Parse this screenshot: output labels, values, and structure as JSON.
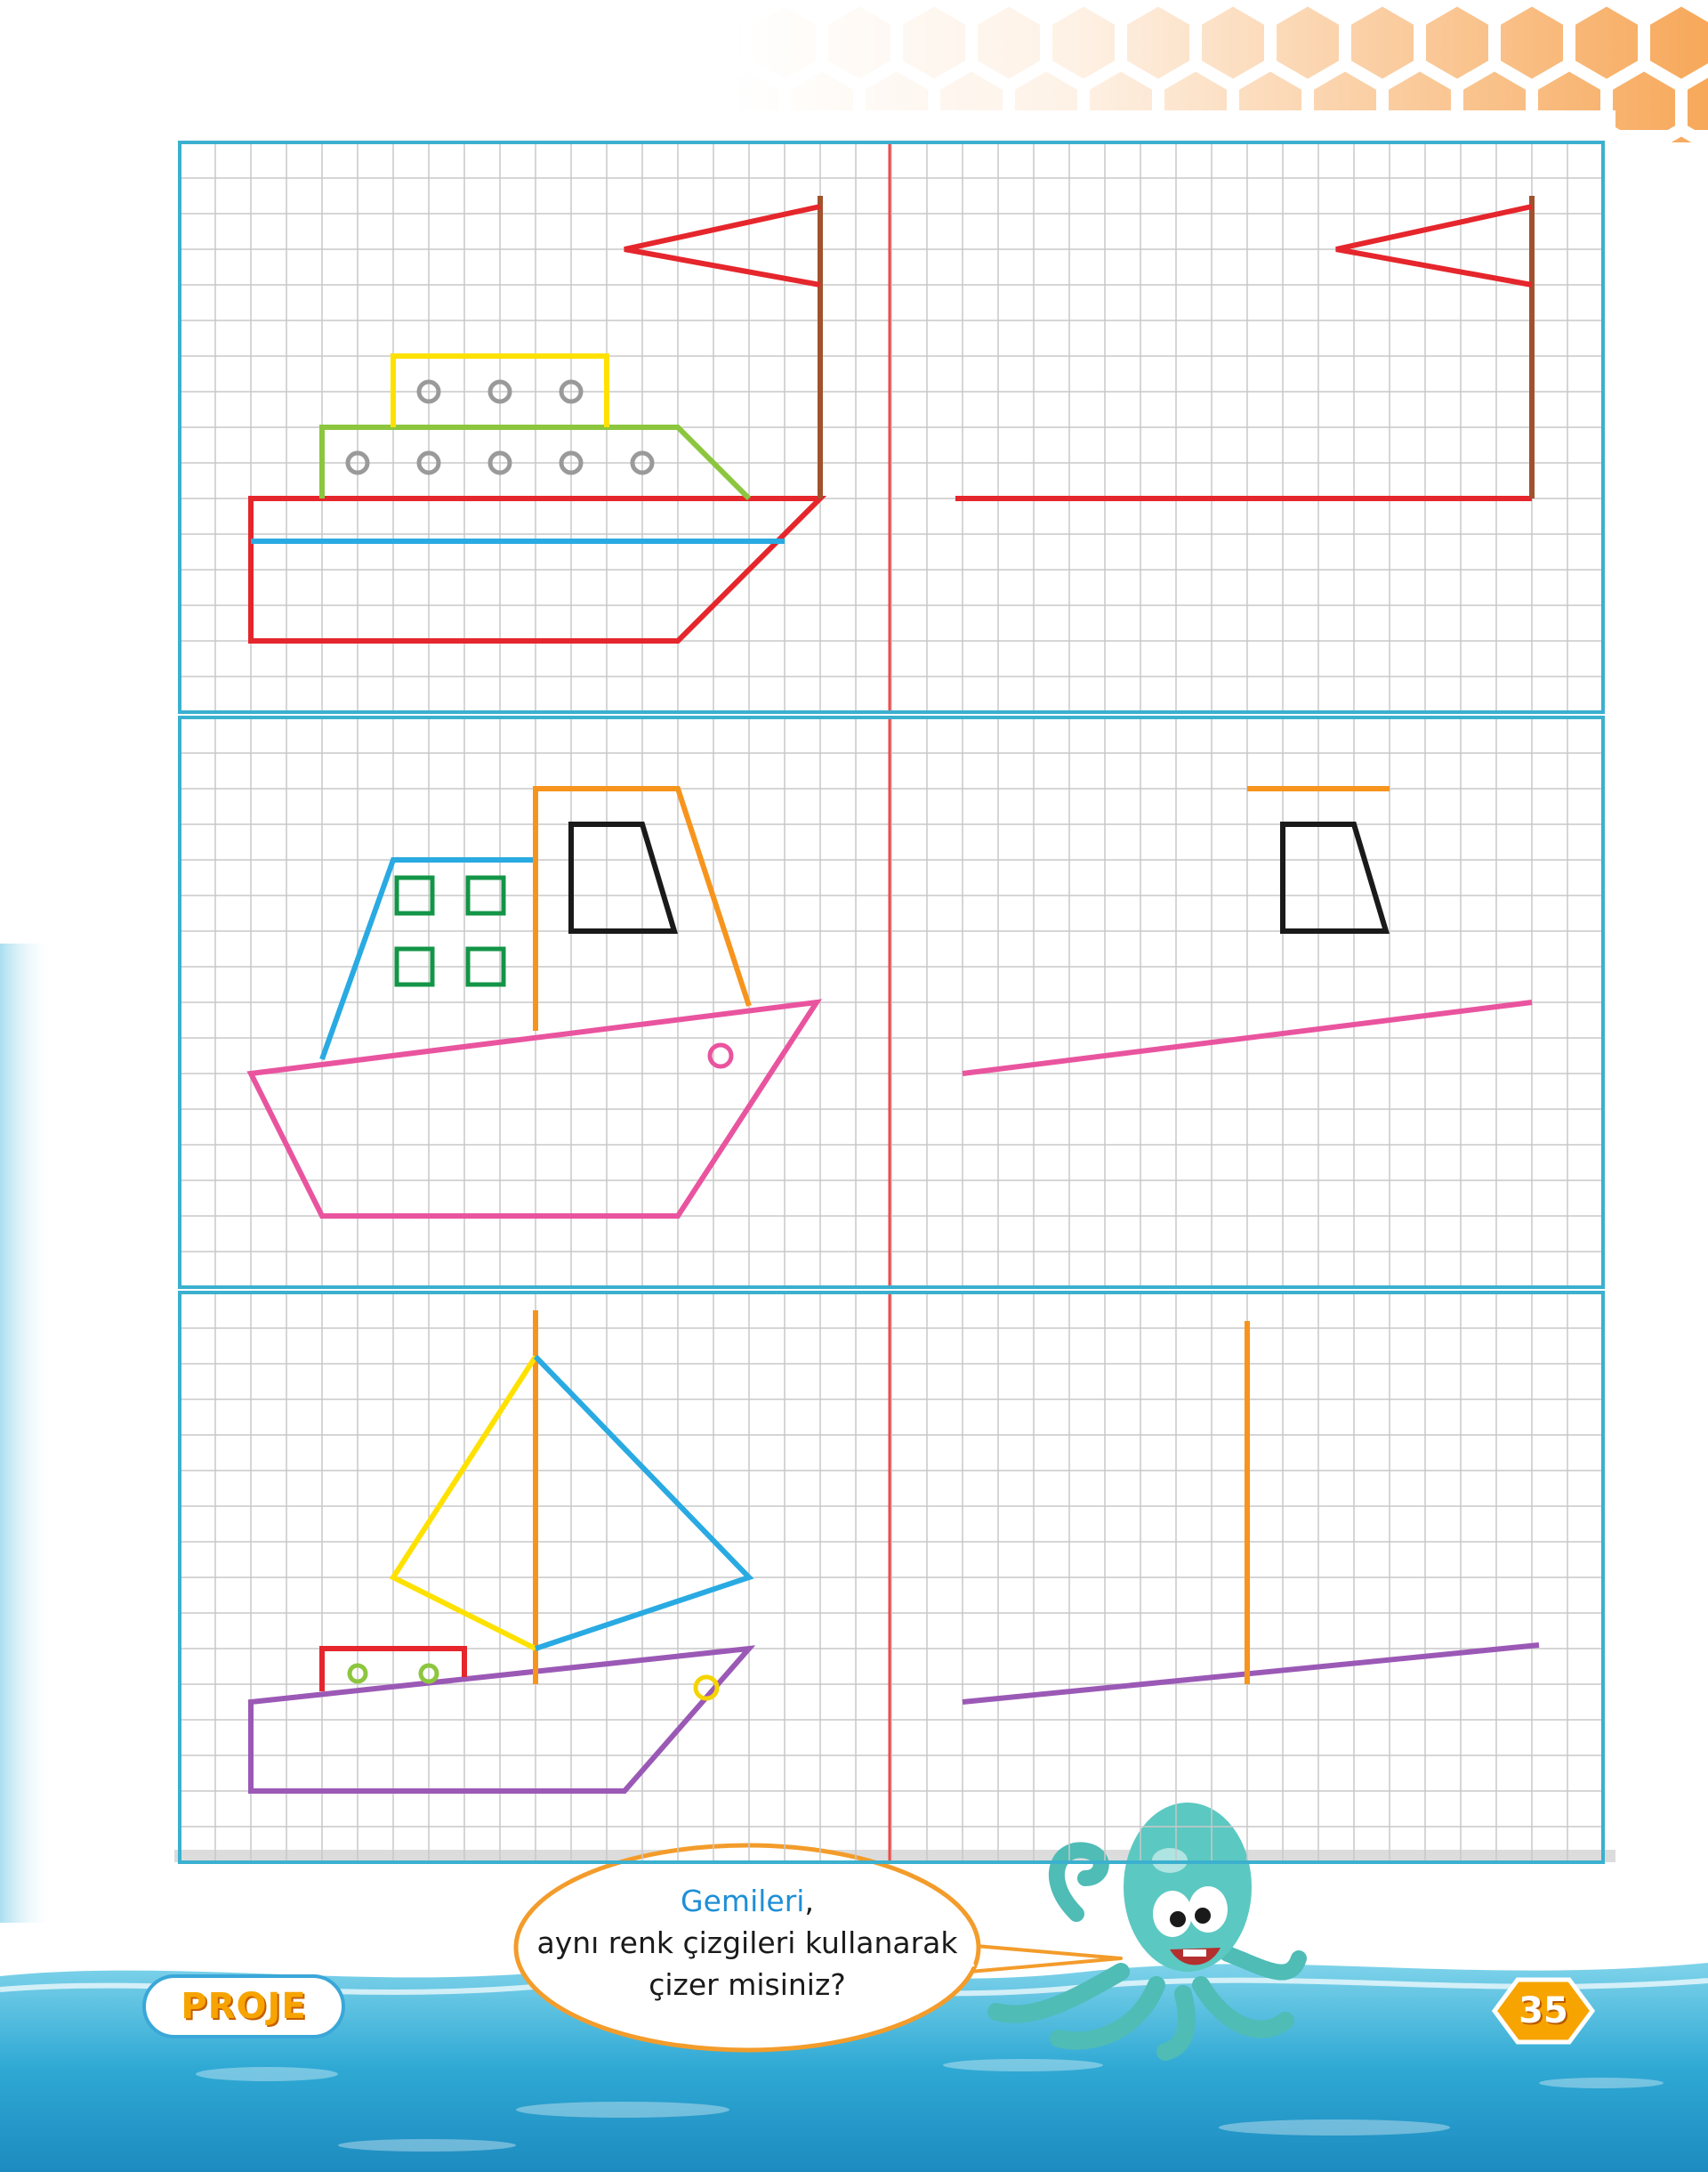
{
  "bubble": {
    "line1_highlight": "Gemileri",
    "line1_rest": ",",
    "line2": "aynı renk çizgileri kullanarak",
    "line3": "çizer misiniz?"
  },
  "badge": {
    "label": "PROJE"
  },
  "page": {
    "number": "35"
  },
  "colors": {
    "grid_border": "#3bb0cf",
    "grid_line": "#c8c8c8",
    "divider": "#ef4a4a",
    "red": "#e5262c",
    "brown": "#a0522d",
    "yellow": "#ffe100",
    "green": "#8cc63f",
    "gray": "#9a9a9a",
    "blue": "#29aae2",
    "orange": "#f7941d",
    "black": "#1a1a1a",
    "dark_green": "#139547",
    "pink": "#e9549f",
    "purple": "#9b59b6",
    "olive": "#8cc63f",
    "gold": "#f4d400"
  }
}
